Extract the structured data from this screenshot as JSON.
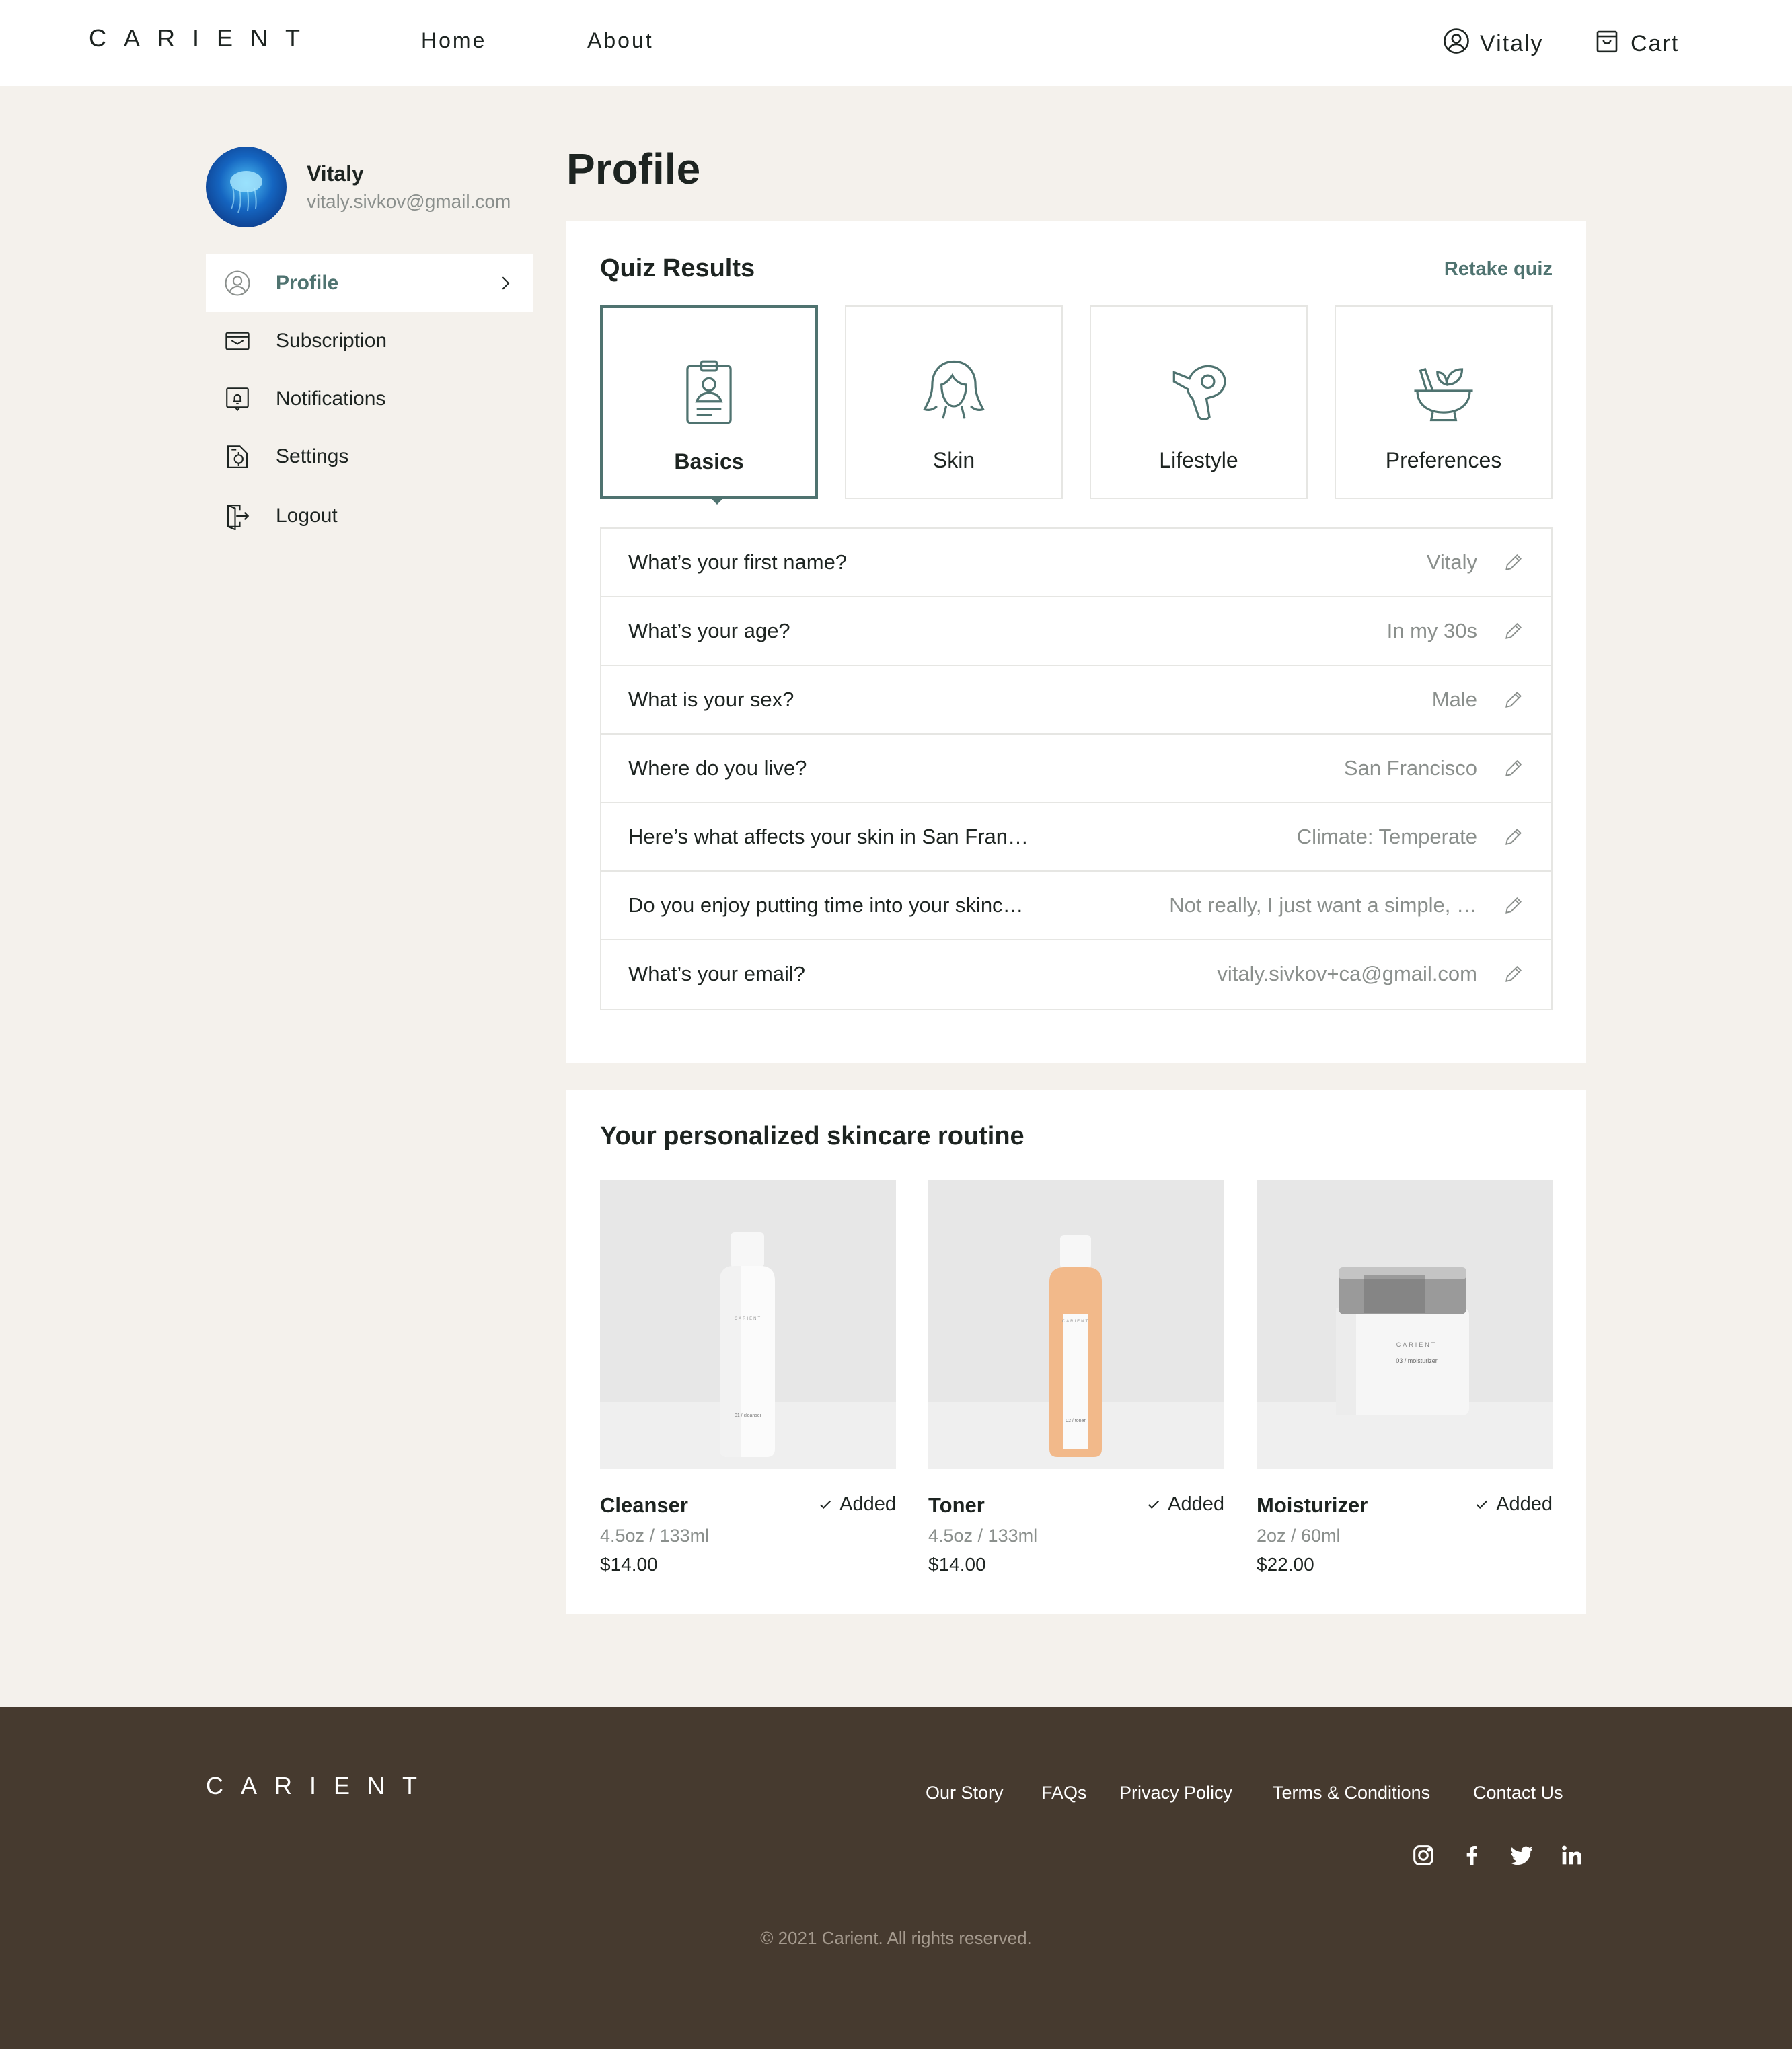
{
  "brand": {
    "logo_text": "CARIENT",
    "accent_color": "#4f7370",
    "footer_bg": "#463a2f"
  },
  "header": {
    "nav": {
      "home": "Home",
      "about": "About"
    },
    "user_label": "Vitaly",
    "cart_label": "Cart"
  },
  "sidebar": {
    "user": {
      "name": "Vitaly",
      "email": "vitaly.sivkov@gmail.com"
    },
    "items": [
      {
        "label": "Profile",
        "icon": "user-circle-icon",
        "active": true
      },
      {
        "label": "Subscription",
        "icon": "subscription-box-icon"
      },
      {
        "label": "Notifications",
        "icon": "bell-icon"
      },
      {
        "label": "Settings",
        "icon": "settings-icon"
      },
      {
        "label": "Logout",
        "icon": "logout-icon"
      }
    ]
  },
  "main": {
    "title": "Profile",
    "quiz": {
      "title": "Quiz Results",
      "retake": "Retake quiz",
      "tabs": [
        {
          "label": "Basics",
          "icon": "id-badge-icon",
          "active": true
        },
        {
          "label": "Skin",
          "icon": "woman-face-icon"
        },
        {
          "label": "Lifestyle",
          "icon": "hair-dryer-icon"
        },
        {
          "label": "Preferences",
          "icon": "mortar-pestle-icon"
        }
      ],
      "rows": [
        {
          "q": "What’s your first name?",
          "a": "Vitaly"
        },
        {
          "q": "What’s your age?",
          "a": "In my 30s"
        },
        {
          "q": "What is your sex?",
          "a": "Male"
        },
        {
          "q": "Where do you live?",
          "a": "San Francisco"
        },
        {
          "q": "Here’s what affects your skin in San Fran…",
          "a": "Climate: Temperate"
        },
        {
          "q": "Do you enjoy putting time into your skinc…",
          "a": "Not really, I just want a simple, …"
        },
        {
          "q": "What’s your email?",
          "a": "vitaly.sivkov+ca@gmail.com"
        }
      ]
    },
    "routine": {
      "title": "Your personalized skincare routine",
      "products": [
        {
          "name": "Cleanser",
          "status": "Added",
          "size": "4.5oz / 133ml",
          "price": "$14.00",
          "label_text": "01 / cleanser"
        },
        {
          "name": "Toner",
          "status": "Added",
          "size": "4.5oz / 133ml",
          "price": "$14.00",
          "label_text": "02 / toner"
        },
        {
          "name": "Moisturizer",
          "status": "Added",
          "size": "2oz / 60ml",
          "price": "$22.00",
          "label_text": "03 / moisturizer"
        }
      ]
    }
  },
  "footer": {
    "links": [
      "Our Story",
      "FAQs",
      "Privacy Policy",
      "Terms & Conditions",
      "Contact Us"
    ],
    "social": [
      "instagram-icon",
      "facebook-icon",
      "twitter-icon",
      "linkedin-icon"
    ],
    "copyright": "© 2021 Carient. All rights reserved."
  }
}
